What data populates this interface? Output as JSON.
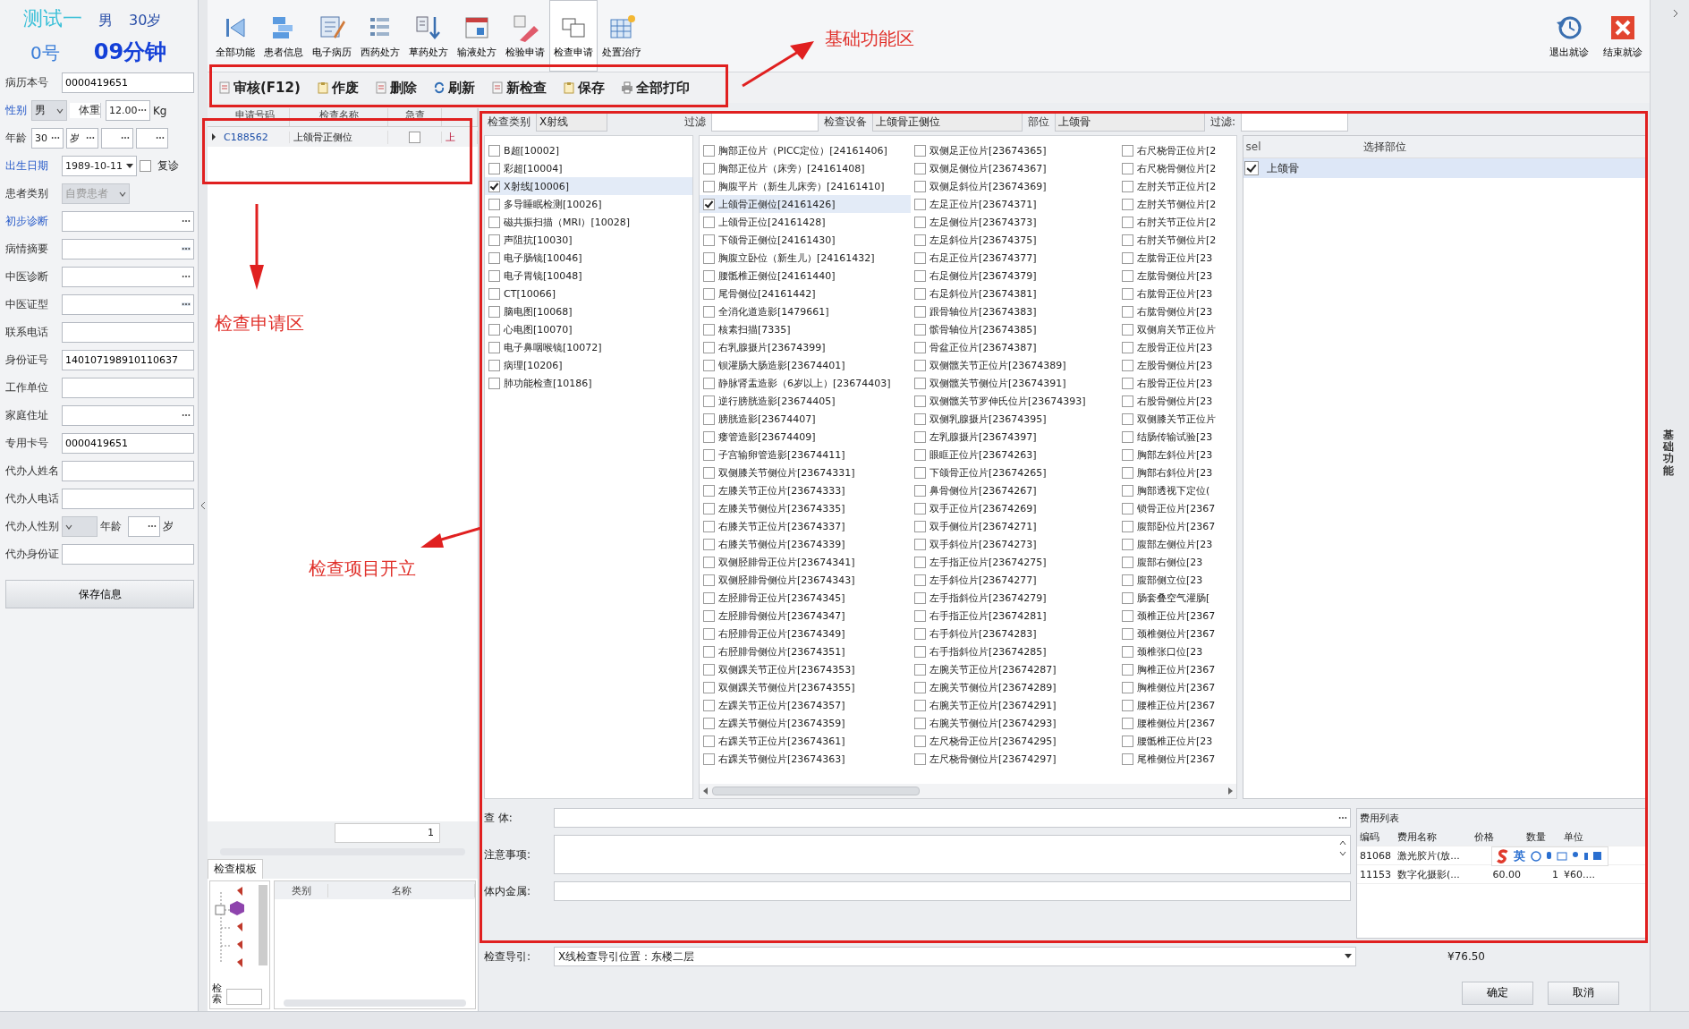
{
  "patient": {
    "name": "测试一",
    "sex": "男",
    "age": "30岁",
    "number": "0号",
    "elapsed": "09分钟"
  },
  "form": {
    "record_no": {
      "label": "病历本号",
      "value": "0000419651"
    },
    "sex": {
      "label": "性别",
      "value": "男",
      "required": true
    },
    "weight": {
      "label": "体重",
      "value": "12.00",
      "unit": "Kg"
    },
    "age": {
      "label": "年龄",
      "value": "30",
      "unit": "岁"
    },
    "birth": {
      "label": "出生日期",
      "value": "1989-10-11",
      "required": true
    },
    "revisit": {
      "label": "复诊",
      "checked": false
    },
    "patient_type": {
      "label": "患者类别",
      "value": "自费患者",
      "disabled": true
    },
    "fields": [
      {
        "label": "初步诊断",
        "kind": "lookup",
        "required": true
      },
      {
        "label": "病情摘要",
        "kind": "button"
      },
      {
        "label": "中医诊断",
        "kind": "lookup"
      },
      {
        "label": "中医证型",
        "kind": "button"
      },
      {
        "label": "联系电话",
        "kind": "text"
      },
      {
        "label": "身份证号",
        "kind": "text",
        "value": "140107198910110637"
      },
      {
        "label": "工作单位",
        "kind": "text"
      },
      {
        "label": "家庭住址",
        "kind": "lookup"
      },
      {
        "label": "专用卡号",
        "kind": "text",
        "value": "0000419651"
      },
      {
        "label": "代办人姓名",
        "kind": "text"
      },
      {
        "label": "代办人电话",
        "kind": "text"
      }
    ],
    "agent_sex": {
      "label": "代办人性别",
      "age_label": "年龄",
      "age_unit": "岁"
    },
    "agent_id": {
      "label": "代办身份证"
    },
    "save_button": "保存信息"
  },
  "toolbar": [
    {
      "label": "全部功能",
      "selected": false
    },
    {
      "label": "患者信息",
      "selected": false
    },
    {
      "label": "电子病历",
      "selected": false
    },
    {
      "label": "西药处方",
      "selected": false
    },
    {
      "label": "草药处方",
      "selected": false
    },
    {
      "label": "输液处方",
      "selected": false
    },
    {
      "label": "检验申请",
      "selected": false
    },
    {
      "label": "检查申请",
      "selected": true
    },
    {
      "label": "处置治疗",
      "selected": false
    }
  ],
  "exit_buttons": [
    "退出就诊",
    "结束就诊"
  ],
  "actions": [
    "审核(F12)",
    "作废",
    "删除",
    "刷新",
    "新检查",
    "保存",
    "全部打印"
  ],
  "requests": {
    "columns": [
      "申请号码",
      "检查名称",
      "急查"
    ],
    "rows": [
      {
        "no": "C188562",
        "name": "上颌骨正侧位",
        "urgent": false,
        "column_4": "上"
      }
    ],
    "page": "1"
  },
  "template": {
    "tab": "检查模板",
    "columns": [
      "类别",
      "名称"
    ],
    "search_label": "检索"
  },
  "filters": {
    "category_label": "检查类别",
    "category": "X射线",
    "filter_label": "过滤",
    "device_label": "检查设备",
    "device": "上颌骨正侧位",
    "part_label": "部位",
    "part": "上颌骨",
    "part_filter_label": "过滤:"
  },
  "categories": [
    {
      "label": "B超[10002]",
      "checked": false
    },
    {
      "label": "彩超[10004]",
      "checked": false
    },
    {
      "label": "X射线[10006]",
      "checked": true
    },
    {
      "label": "多导睡眠检测[10026]",
      "checked": false
    },
    {
      "label": "磁共振扫描（MRI）[10028]",
      "checked": false
    },
    {
      "label": "声阻抗[10030]",
      "checked": false
    },
    {
      "label": "电子肠镜[10046]",
      "checked": false
    },
    {
      "label": "电子胃镜[10048]",
      "checked": false
    },
    {
      "label": "CT[10066]",
      "checked": false
    },
    {
      "label": "脑电图[10068]",
      "checked": false
    },
    {
      "label": "心电图[10070]",
      "checked": false
    },
    {
      "label": "电子鼻咽喉镜[10072]",
      "checked": false
    },
    {
      "label": "病理[10206]",
      "checked": false
    },
    {
      "label": "肺功能检查[10186]",
      "checked": false
    }
  ],
  "exam_items": [
    {
      "label": "胸部正位片（PICC定位）[24161406]",
      "checked": false
    },
    {
      "label": "胸部正位片（床旁）[24161408]",
      "checked": false
    },
    {
      "label": "胸腹平片（新生儿床旁）[24161410]",
      "checked": false
    },
    {
      "label": "上颌骨正侧位[24161426]",
      "checked": true
    },
    {
      "label": "上颌骨正位[24161428]",
      "checked": false
    },
    {
      "label": "下颌骨正侧位[24161430]",
      "checked": false
    },
    {
      "label": "胸腹立卧位（新生儿）[24161432]",
      "checked": false
    },
    {
      "label": "腰骶椎正侧位[24161440]",
      "checked": false
    },
    {
      "label": "尾骨侧位[24161442]",
      "checked": false
    },
    {
      "label": "全消化道造影[1479661]",
      "checked": false
    },
    {
      "label": "核素扫描[7335]",
      "checked": false
    },
    {
      "label": "右乳腺摄片[23674399]",
      "checked": false
    },
    {
      "label": "钡灌肠大肠造影[23674401]",
      "checked": false
    },
    {
      "label": "静脉肾盂造影（6岁以上）[23674403]",
      "checked": false
    },
    {
      "label": "逆行膀胱造影[23674405]",
      "checked": false
    },
    {
      "label": "膀胱造影[23674407]",
      "checked": false
    },
    {
      "label": "瘘管造影[23674409]",
      "checked": false
    },
    {
      "label": "子宫输卵管造影[23674411]",
      "checked": false
    },
    {
      "label": "双侧膝关节侧位片[23674331]",
      "checked": false
    },
    {
      "label": "左膝关节正位片[23674333]",
      "checked": false
    },
    {
      "label": "左膝关节侧位片[23674335]",
      "checked": false
    },
    {
      "label": "右膝关节正位片[23674337]",
      "checked": false
    },
    {
      "label": "右膝关节侧位片[23674339]",
      "checked": false
    },
    {
      "label": "双侧胫腓骨正位片[23674341]",
      "checked": false
    },
    {
      "label": "双侧胫腓骨侧位片[23674343]",
      "checked": false
    },
    {
      "label": "左胫腓骨正位片[23674345]",
      "checked": false
    },
    {
      "label": "左胫腓骨侧位片[23674347]",
      "checked": false
    },
    {
      "label": "右胫腓骨正位片[23674349]",
      "checked": false
    },
    {
      "label": "右胫腓骨侧位片[23674351]",
      "checked": false
    },
    {
      "label": "双侧踝关节正位片[23674353]",
      "checked": false
    },
    {
      "label": "双侧踝关节侧位片[23674355]",
      "checked": false
    },
    {
      "label": "左踝关节正位片[23674357]",
      "checked": false
    },
    {
      "label": "左踝关节侧位片[23674359]",
      "checked": false
    },
    {
      "label": "右踝关节正位片[23674361]",
      "checked": false
    },
    {
      "label": "右踝关节侧位片[23674363]",
      "checked": false
    },
    {
      "label": "双侧足正位片[23674365]",
      "checked": false
    },
    {
      "label": "双侧足侧位片[23674367]",
      "checked": false
    },
    {
      "label": "双侧足斜位片[23674369]",
      "checked": false
    },
    {
      "label": "左足正位片[23674371]",
      "checked": false
    },
    {
      "label": "左足侧位片[23674373]",
      "checked": false
    },
    {
      "label": "左足斜位片[23674375]",
      "checked": false
    },
    {
      "label": "右足正位片[23674377]",
      "checked": false
    },
    {
      "label": "右足侧位片[23674379]",
      "checked": false
    },
    {
      "label": "右足斜位片[23674381]",
      "checked": false
    },
    {
      "label": "跟骨轴位片[23674383]",
      "checked": false
    },
    {
      "label": "髌骨轴位片[23674385]",
      "checked": false
    },
    {
      "label": "骨盆正位片[23674387]",
      "checked": false
    },
    {
      "label": "双侧髋关节正位片[23674389]",
      "checked": false
    },
    {
      "label": "双侧髋关节侧位片[23674391]",
      "checked": false
    },
    {
      "label": "双侧髋关节罗伸氏位片[23674393]",
      "checked": false
    },
    {
      "label": "双侧乳腺摄片[23674395]",
      "checked": false
    },
    {
      "label": "左乳腺摄片[23674397]",
      "checked": false
    },
    {
      "label": "眼眶正位片[23674263]",
      "checked": false
    },
    {
      "label": "下颌骨正位片[23674265]",
      "checked": false
    },
    {
      "label": "鼻骨侧位片[23674267]",
      "checked": false
    },
    {
      "label": "双手正位片[23674269]",
      "checked": false
    },
    {
      "label": "双手侧位片[23674271]",
      "checked": false
    },
    {
      "label": "双手斜位片[23674273]",
      "checked": false
    },
    {
      "label": "左手指正位片[23674275]",
      "checked": false
    },
    {
      "label": "左手斜位片[23674277]",
      "checked": false
    },
    {
      "label": "左手指斜位片[23674279]",
      "checked": false
    },
    {
      "label": "右手指正位片[23674281]",
      "checked": false
    },
    {
      "label": "右手斜位片[23674283]",
      "checked": false
    },
    {
      "label": "右手指斜位片[23674285]",
      "checked": false
    },
    {
      "label": "左腕关节正位片[23674287]",
      "checked": false
    },
    {
      "label": "左腕关节侧位片[23674289]",
      "checked": false
    },
    {
      "label": "右腕关节正位片[23674291]",
      "checked": false
    },
    {
      "label": "右腕关节侧位片[23674293]",
      "checked": false
    },
    {
      "label": "左尺桡骨正位片[23674295]",
      "checked": false
    },
    {
      "label": "左尺桡骨侧位片[23674297]",
      "checked": false
    },
    {
      "label": "右尺桡骨正位片[2",
      "checked": false
    },
    {
      "label": "右尺桡骨侧位片[2",
      "checked": false
    },
    {
      "label": "左肘关节正位片[2",
      "checked": false
    },
    {
      "label": "左肘关节侧位片[2",
      "checked": false
    },
    {
      "label": "右肘关节正位片[2",
      "checked": false
    },
    {
      "label": "右肘关节侧位片[2",
      "checked": false
    },
    {
      "label": "左肱骨正位片[23",
      "checked": false
    },
    {
      "label": "左肱骨侧位片[23",
      "checked": false
    },
    {
      "label": "右肱骨正位片[23",
      "checked": false
    },
    {
      "label": "右肱骨侧位片[23",
      "checked": false
    },
    {
      "label": "双侧肩关节正位片",
      "checked": false
    },
    {
      "label": "左股骨正位片[23",
      "checked": false
    },
    {
      "label": "左股骨侧位片[23",
      "checked": false
    },
    {
      "label": "右股骨正位片[23",
      "checked": false
    },
    {
      "label": "右股骨侧位片[23",
      "checked": false
    },
    {
      "label": "双侧膝关节正位片",
      "checked": false
    },
    {
      "label": "结肠传输试验[23",
      "checked": false
    },
    {
      "label": "胸部左斜位片[23",
      "checked": false
    },
    {
      "label": "胸部右斜位片[23",
      "checked": false
    },
    {
      "label": "胸部透视下定位(",
      "checked": false
    },
    {
      "label": "锁骨正位片[2367",
      "checked": false
    },
    {
      "label": "腹部卧位片[2367",
      "checked": false
    },
    {
      "label": "腹部左侧位片[23",
      "checked": false
    },
    {
      "label": "腹部右侧位[23",
      "checked": false
    },
    {
      "label": "腹部侧立位[23",
      "checked": false
    },
    {
      "label": "肠套叠空气灌肠[",
      "checked": false
    },
    {
      "label": "颈椎正位片[2367",
      "checked": false
    },
    {
      "label": "颈椎侧位片[2367",
      "checked": false
    },
    {
      "label": "颈椎张口位[23",
      "checked": false
    },
    {
      "label": "胸椎正位片[2367",
      "checked": false
    },
    {
      "label": "胸椎侧位片[2367",
      "checked": false
    },
    {
      "label": "腰椎正位片[2367",
      "checked": false
    },
    {
      "label": "腰椎侧位片[2367",
      "checked": false
    },
    {
      "label": "腰骶椎正位片[23",
      "checked": false
    },
    {
      "label": "尾椎侧位片[2367",
      "checked": false
    }
  ],
  "parts": {
    "columns": [
      "sel",
      "选择部位"
    ],
    "rows": [
      {
        "name": "上颌骨",
        "checked": true,
        "selected": true
      }
    ]
  },
  "notes": {
    "exam_label": "查 体:",
    "caution_label": "注意事项:",
    "metal_label": "体内金属:",
    "guide_label": "检查导引:",
    "guide": "X线检查导引位置：东楼二层"
  },
  "fees": {
    "title": "费用列表",
    "columns": [
      "编码",
      "费用名称",
      "价格",
      "数量",
      "单位"
    ],
    "rows": [
      {
        "code": "81068",
        "name": "激光胶片(放...",
        "price": "",
        "qty": "",
        "unit": ""
      },
      {
        "code": "11153",
        "name": "数字化摄影(...",
        "price": "60.00",
        "qty": "1",
        "unit": "¥60...."
      }
    ],
    "total": "¥76.50"
  },
  "ime": {
    "label": "英"
  },
  "dialog_buttons": [
    "确定",
    "取消"
  ],
  "side_tab": "基础功能",
  "annotations": [
    {
      "text": "基础功能区",
      "kind": "toolbar"
    },
    {
      "text": "检查申请区",
      "kind": "requests"
    },
    {
      "text": "检查项目开立",
      "kind": "items"
    }
  ]
}
